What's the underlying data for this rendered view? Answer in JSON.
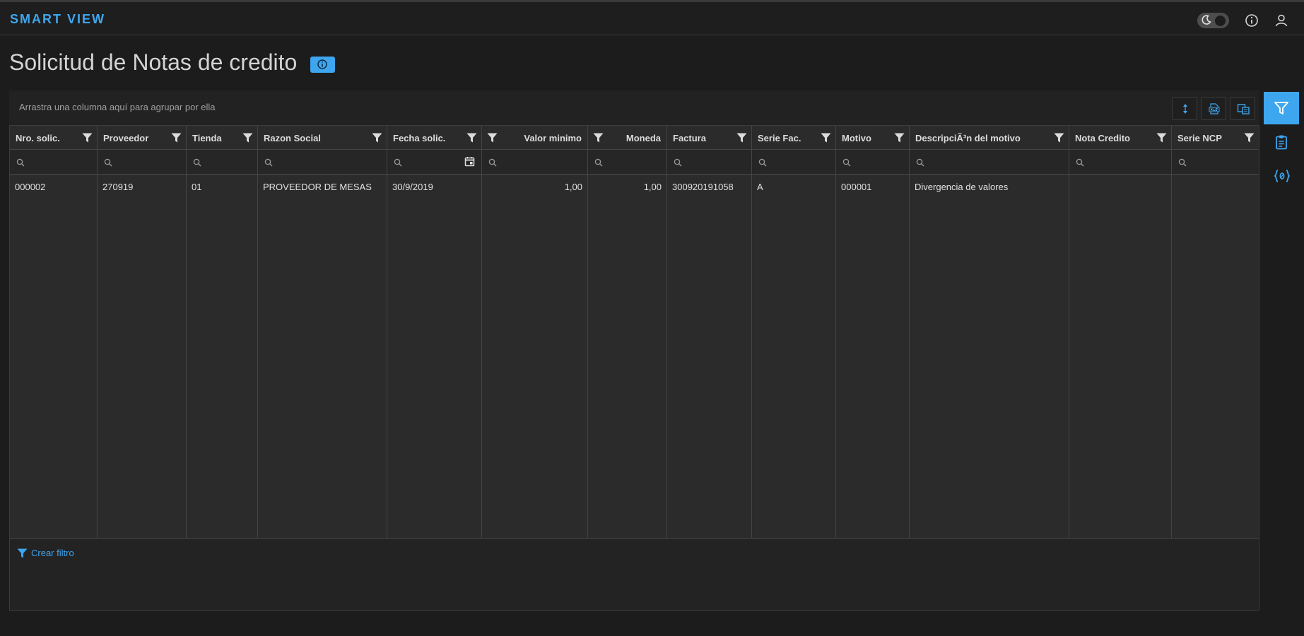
{
  "app": {
    "brand": "SMART VIEW"
  },
  "header_icons": [
    "moon-icon",
    "info-icon",
    "user-icon"
  ],
  "page": {
    "title": "Solicitud de Notas de credito",
    "info_icon": "info-icon"
  },
  "toolbar": {
    "group_hint": "Arrastra una columna aquí para agrupar por ella",
    "buttons": [
      "expand-collapse-icon",
      "export-excel-icon",
      "column-chooser-icon"
    ]
  },
  "grid": {
    "columns": [
      {
        "label": "Nro. solic."
      },
      {
        "label": "Proveedor"
      },
      {
        "label": "Tienda"
      },
      {
        "label": "Razon Social"
      },
      {
        "label": "Fecha solic."
      },
      {
        "label": "Valor minimo"
      },
      {
        "label": "Moneda"
      },
      {
        "label": "Factura"
      },
      {
        "label": "Serie Fac."
      },
      {
        "label": "Motivo"
      },
      {
        "label": "DescripciÃ³n del motivo"
      },
      {
        "label": "Nota Credito"
      },
      {
        "label": "Serie NCP"
      }
    ],
    "rows": [
      [
        "000002",
        "270919",
        "01",
        "PROVEEDOR DE MESAS",
        "30/9/2019",
        "1,00",
        "1,00",
        "300920191058",
        "A",
        "000001",
        "Divergencia de valores",
        "",
        ""
      ]
    ]
  },
  "footer": {
    "create_filter": "Crear filtro"
  },
  "side_rail": [
    "filter-icon",
    "clipboard-icon",
    "json-icon"
  ],
  "colors": {
    "accent": "#3ea6ef",
    "background": "#1c1c1c",
    "grid": "#2b2b2b"
  }
}
